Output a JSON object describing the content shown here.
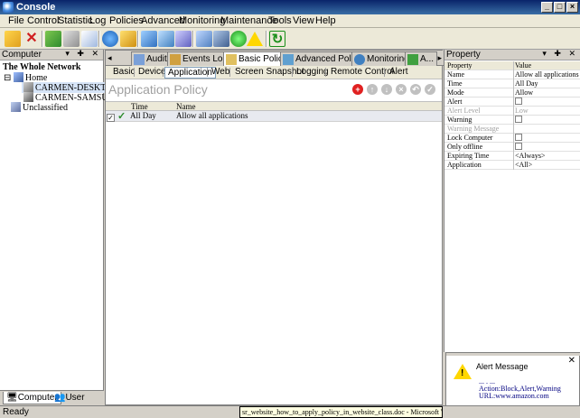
{
  "window": {
    "title": "Console"
  },
  "menu": [
    "File",
    "Control",
    "Statistic",
    "Log",
    "Policies",
    "Advanced",
    "Monitoring",
    "Maintenance",
    "Tools",
    "View",
    "Help"
  ],
  "left_panel": {
    "header": "Computer",
    "tree": {
      "root": "The Whole Network",
      "group": "Home",
      "computers": [
        "CARMEN-DESKTOP",
        "CARMEN-SAMSUNG"
      ],
      "unclassified": "Unclassified"
    },
    "tabs": [
      "Computer",
      "User"
    ]
  },
  "center": {
    "tabs": [
      "Audit",
      "Events Log",
      "Basic Policy",
      "Advanced Policy",
      "Monitoring",
      "A..."
    ],
    "subtabs": [
      "Basic",
      "Device",
      "Application",
      "Web",
      "Screen Snapshot",
      "Logging",
      "Remote Control",
      "Alert"
    ],
    "policy_title": "Application Policy",
    "grid": {
      "columns": [
        "Time",
        "Name"
      ],
      "rows": [
        {
          "time": "All Day",
          "name": "Allow all applications"
        }
      ]
    }
  },
  "property": {
    "header": "Property",
    "col_property": "Property",
    "col_value": "Value",
    "rows": [
      {
        "name": "Name",
        "value": "Allow all applications"
      },
      {
        "name": "Time",
        "value": "All Day"
      },
      {
        "name": "Mode",
        "value": "Allow"
      },
      {
        "name": "Alert",
        "value": ""
      },
      {
        "name": "Alert Level",
        "value": "Low"
      },
      {
        "name": "Warning",
        "value": ""
      },
      {
        "name": "Warning Message",
        "value": ""
      },
      {
        "name": "Lock Computer",
        "value": ""
      },
      {
        "name": "Only offline",
        "value": ""
      },
      {
        "name": "Expiring Time",
        "value": "<Always>"
      },
      {
        "name": "Application",
        "value": "<All>"
      }
    ]
  },
  "alert": {
    "title": "Alert Message",
    "line1": "... . ...",
    "line2": "Action:Block,Alert,Warning",
    "line3": "URL:www.amazon.com"
  },
  "status": {
    "text": "Ready",
    "taskbar_tooltip": "sr_website_how_to_apply_policy_in_website_class.doc - Microsoft Word"
  },
  "colors": {
    "title_gradient_start": "#0a246a",
    "title_gradient_end": "#3a6ea5",
    "add_button": "#e02020"
  }
}
